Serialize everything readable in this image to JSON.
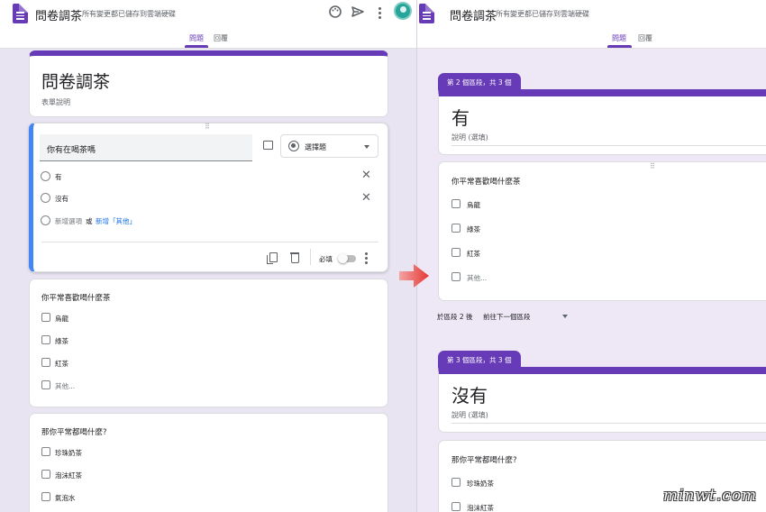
{
  "left": {
    "header": {
      "title": "問卷調茶",
      "save_status": "所有變更都已儲存到雲端硬碟"
    },
    "tabs": [
      {
        "label": "問題",
        "active": true
      },
      {
        "label": "回覆",
        "active": false
      }
    ],
    "form": {
      "title": "問卷調茶",
      "description": "表單說明"
    },
    "active_question": {
      "question": "你有在喝茶嗎",
      "type": "選擇題",
      "options": [
        "有",
        "沒有"
      ],
      "add_option": "新增選項",
      "or": "或",
      "add_other": "新增「其他」",
      "required_label": "必填"
    },
    "question2": {
      "title": "你平常喜歡喝什麼茶",
      "options": [
        "烏龍",
        "綠茶",
        "紅茶",
        "其他..."
      ]
    },
    "question3": {
      "title": "那你平常都喝什麼?",
      "options": [
        "珍珠奶茶",
        "泡沫紅茶",
        "氣泡水"
      ]
    }
  },
  "right": {
    "header": {
      "title": "問卷調茶",
      "save_status": "所有變更都已儲存到雲端硬碟"
    },
    "tabs": [
      {
        "label": "問題",
        "active": true
      },
      {
        "label": "回覆",
        "active": false
      }
    ],
    "section2": {
      "tab": "第 2 個區段，共 3 個",
      "title": "有",
      "description_placeholder": "說明 (選填)"
    },
    "question": {
      "title": "你平常喜歡喝什麼茶",
      "options": [
        "烏龍",
        "綠茶",
        "紅茶",
        "其他..."
      ]
    },
    "after_section": {
      "label": "於區段 2 後",
      "value": "前往下一個區段"
    },
    "section3": {
      "tab": "第 3 個區段，共 3 個",
      "title": "沒有",
      "description_placeholder": "說明 (選填)"
    },
    "question3": {
      "title": "那你平常都喝什麼?",
      "options": [
        "珍珠奶茶",
        "泡沫紅茶"
      ]
    }
  },
  "watermark": "minwt.com",
  "colors": {
    "accent": "#673ab7",
    "active_border": "#4285f4",
    "link": "#1a73e8",
    "arrow": "#e53935",
    "background": "#ede7f6"
  },
  "icons": [
    "forms-logo-icon",
    "palette-icon",
    "send-icon",
    "more-vert-icon",
    "avatar",
    "drag-handle-icon",
    "image-icon",
    "radio-type-icon",
    "dropdown-caret-icon",
    "close-icon",
    "copy-icon",
    "trash-icon",
    "toggle-switch",
    "arrow-right-icon"
  ]
}
